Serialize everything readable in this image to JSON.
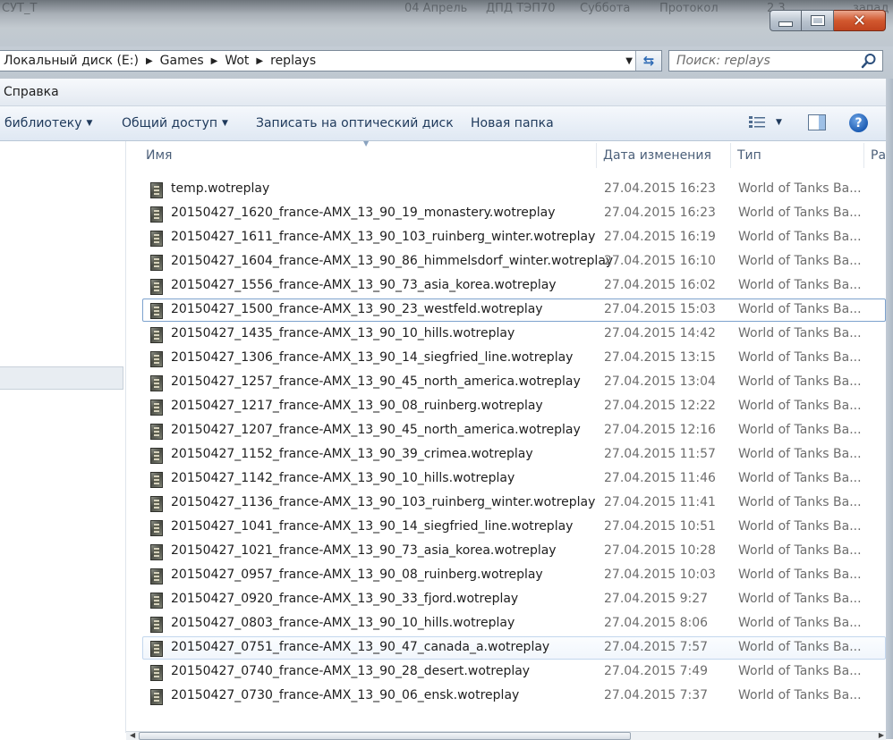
{
  "window": {
    "background_tabs": [
      "СУТ_Т",
      "04 Апрель",
      "ДПД ТЭП70",
      "Суббота",
      "Протокол",
      "2.3",
      "запад"
    ],
    "controls": {
      "minimize": "minimize",
      "maximize": "maximize",
      "close": "✕"
    }
  },
  "address_bar": {
    "crumbs": [
      "Локальный диск (E:)",
      "Games",
      "Wot",
      "replays"
    ],
    "refresh_icon": "refresh-icon"
  },
  "search": {
    "placeholder": "Поиск: replays"
  },
  "menu": {
    "help": "Справка"
  },
  "toolbar": {
    "library": "библиотеку",
    "share": "Общий доступ",
    "burn": "Записать на оптический диск",
    "new_folder": "Новая папка",
    "help_glyph": "?"
  },
  "columns": {
    "name": "Имя",
    "date": "Дата изменения",
    "type": "Тип",
    "size": "Ра"
  },
  "files": [
    {
      "name": "temp.wotreplay",
      "date": "27.04.2015 16:23",
      "type": "World of Tanks Ba..."
    },
    {
      "name": "20150427_1620_france-AMX_13_90_19_monastery.wotreplay",
      "date": "27.04.2015 16:23",
      "type": "World of Tanks Ba..."
    },
    {
      "name": "20150427_1611_france-AMX_13_90_103_ruinberg_winter.wotreplay",
      "date": "27.04.2015 16:19",
      "type": "World of Tanks Ba..."
    },
    {
      "name": "20150427_1604_france-AMX_13_90_86_himmelsdorf_winter.wotreplay",
      "date": "27.04.2015 16:10",
      "type": "World of Tanks Ba..."
    },
    {
      "name": "20150427_1556_france-AMX_13_90_73_asia_korea.wotreplay",
      "date": "27.04.2015 16:02",
      "type": "World of Tanks Ba..."
    },
    {
      "name": "20150427_1500_france-AMX_13_90_23_westfeld.wotreplay",
      "date": "27.04.2015 15:03",
      "type": "World of Tanks Ba..."
    },
    {
      "name": "20150427_1435_france-AMX_13_90_10_hills.wotreplay",
      "date": "27.04.2015 14:42",
      "type": "World of Tanks Ba..."
    },
    {
      "name": "20150427_1306_france-AMX_13_90_14_siegfried_line.wotreplay",
      "date": "27.04.2015 13:15",
      "type": "World of Tanks Ba..."
    },
    {
      "name": "20150427_1257_france-AMX_13_90_45_north_america.wotreplay",
      "date": "27.04.2015 13:04",
      "type": "World of Tanks Ba..."
    },
    {
      "name": "20150427_1217_france-AMX_13_90_08_ruinberg.wotreplay",
      "date": "27.04.2015 12:22",
      "type": "World of Tanks Ba..."
    },
    {
      "name": "20150427_1207_france-AMX_13_90_45_north_america.wotreplay",
      "date": "27.04.2015 12:16",
      "type": "World of Tanks Ba..."
    },
    {
      "name": "20150427_1152_france-AMX_13_90_39_crimea.wotreplay",
      "date": "27.04.2015 11:57",
      "type": "World of Tanks Ba..."
    },
    {
      "name": "20150427_1142_france-AMX_13_90_10_hills.wotreplay",
      "date": "27.04.2015 11:46",
      "type": "World of Tanks Ba..."
    },
    {
      "name": "20150427_1136_france-AMX_13_90_103_ruinberg_winter.wotreplay",
      "date": "27.04.2015 11:41",
      "type": "World of Tanks Ba..."
    },
    {
      "name": "20150427_1041_france-AMX_13_90_14_siegfried_line.wotreplay",
      "date": "27.04.2015 10:51",
      "type": "World of Tanks Ba..."
    },
    {
      "name": "20150427_1021_france-AMX_13_90_73_asia_korea.wotreplay",
      "date": "27.04.2015 10:28",
      "type": "World of Tanks Ba..."
    },
    {
      "name": "20150427_0957_france-AMX_13_90_08_ruinberg.wotreplay",
      "date": "27.04.2015 10:03",
      "type": "World of Tanks Ba..."
    },
    {
      "name": "20150427_0920_france-AMX_13_90_33_fjord.wotreplay",
      "date": "27.04.2015 9:27",
      "type": "World of Tanks Ba..."
    },
    {
      "name": "20150427_0803_france-AMX_13_90_10_hills.wotreplay",
      "date": "27.04.2015 8:06",
      "type": "World of Tanks Ba..."
    },
    {
      "name": "20150427_0751_france-AMX_13_90_47_canada_a.wotreplay",
      "date": "27.04.2015 7:57",
      "type": "World of Tanks Ba..."
    },
    {
      "name": "20150427_0740_france-AMX_13_90_28_desert.wotreplay",
      "date": "27.04.2015 7:49",
      "type": "World of Tanks Ba..."
    },
    {
      "name": "20150427_0730_france-AMX_13_90_06_ensk.wotreplay",
      "date": "27.04.2015 7:37",
      "type": "World of Tanks Ba..."
    }
  ],
  "states": {
    "focused_row": 5,
    "hovered_row": 19
  }
}
